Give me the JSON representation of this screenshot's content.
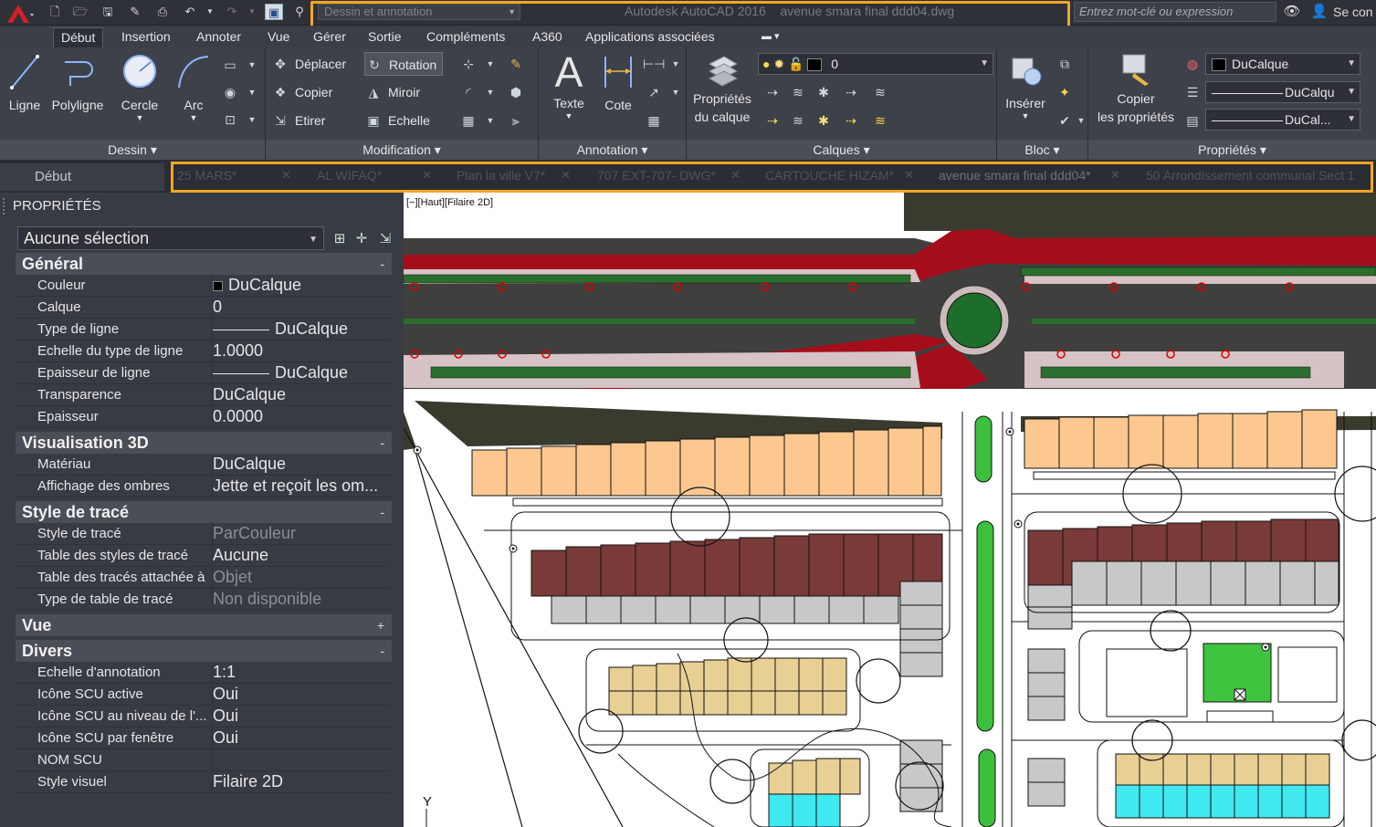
{
  "app": {
    "workspace": "Dessin et annotation",
    "title": "Autodesk AutoCAD 2016    avenue smara final ddd04.dwg",
    "search_placeholder": "Entrez mot-clé ou expression",
    "signin": "Se con",
    "accent": "#f5a623"
  },
  "ribbon_tabs": [
    "Début",
    "Insertion",
    "Annoter",
    "Vue",
    "Gérer",
    "Sortie",
    "Compléments",
    "A360",
    "Applications associées"
  ],
  "ribbon": {
    "dessin": {
      "label": "Dessin",
      "ligne": "Ligne",
      "polyligne": "Polyligne",
      "cercle": "Cercle",
      "arc": "Arc"
    },
    "modification": {
      "label": "Modification",
      "deplacer": "Déplacer",
      "rotation": "Rotation",
      "copier": "Copier",
      "miroir": "Miroir",
      "etirer": "Etirer",
      "echelle": "Echelle"
    },
    "annotation": {
      "label": "Annotation",
      "texte": "Texte",
      "cote": "Cote"
    },
    "calques": {
      "label": "Calques",
      "proprietes_l1": "Propriétés",
      "proprietes_l2": "du calque",
      "layer_value": "0"
    },
    "bloc": {
      "label": "Bloc",
      "inserer": "Insérer"
    },
    "proprietes": {
      "label": "Propriétés",
      "copier_l1": "Copier",
      "copier_l2": "les propriétés",
      "color": "DuCalque",
      "linetype": "DuCalqu",
      "lineweight": "DuCal..."
    }
  },
  "file_tabs": {
    "start": "Début",
    "items": [
      "25 MARS*",
      "AL WIFAQ*",
      "Plan la ville V7*",
      "707 EXT-707- DWG*",
      "CARTOUCHE HIZAM*",
      "avenue smara final ddd04*",
      "50 Arrondissement communal Sect 1"
    ]
  },
  "properties": {
    "title": "PROPRIÉTÉS",
    "selection": "Aucune sélection",
    "sections": {
      "general": {
        "label": "Général",
        "toggle": "-",
        "rows": [
          {
            "name": "Couleur",
            "value": "DuCalque"
          },
          {
            "name": "Calque",
            "value": "0"
          },
          {
            "name": "Type de ligne",
            "value": "DuCalque"
          },
          {
            "name": "Echelle du type de ligne",
            "value": "1.0000"
          },
          {
            "name": "Epaisseur de ligne",
            "value": "DuCalque"
          },
          {
            "name": "Transparence",
            "value": "DuCalque"
          },
          {
            "name": "Epaisseur",
            "value": "0.0000"
          }
        ]
      },
      "vis3d": {
        "label": "Visualisation 3D",
        "toggle": "-",
        "rows": [
          {
            "name": "Matériau",
            "value": "DuCalque"
          },
          {
            "name": "Affichage des ombres",
            "value": "Jette et reçoit les om..."
          }
        ]
      },
      "plot": {
        "label": "Style de tracé",
        "toggle": "-",
        "rows": [
          {
            "name": "Style de tracé",
            "value": "ParCouleur"
          },
          {
            "name": "Table des styles de tracé",
            "value": "Aucune"
          },
          {
            "name": "Table des tracés attachée à",
            "value": "Objet"
          },
          {
            "name": "Type de table de tracé",
            "value": "Non disponible"
          }
        ]
      },
      "vue": {
        "label": "Vue",
        "toggle": "+"
      },
      "divers": {
        "label": "Divers",
        "toggle": "-",
        "rows": [
          {
            "name": "Echelle d'annotation",
            "value": "1:1"
          },
          {
            "name": "Icône SCU active",
            "value": "Oui"
          },
          {
            "name": "Icône SCU au niveau de l'...",
            "value": "Oui"
          },
          {
            "name": "Icône SCU par fenêtre",
            "value": "Oui"
          },
          {
            "name": "NOM SCU",
            "value": ""
          },
          {
            "name": "Style visuel",
            "value": "Filaire 2D"
          }
        ]
      }
    }
  },
  "viewport": {
    "label": "[−][Haut][Filaire 2D]",
    "ucs_y": "Y"
  }
}
